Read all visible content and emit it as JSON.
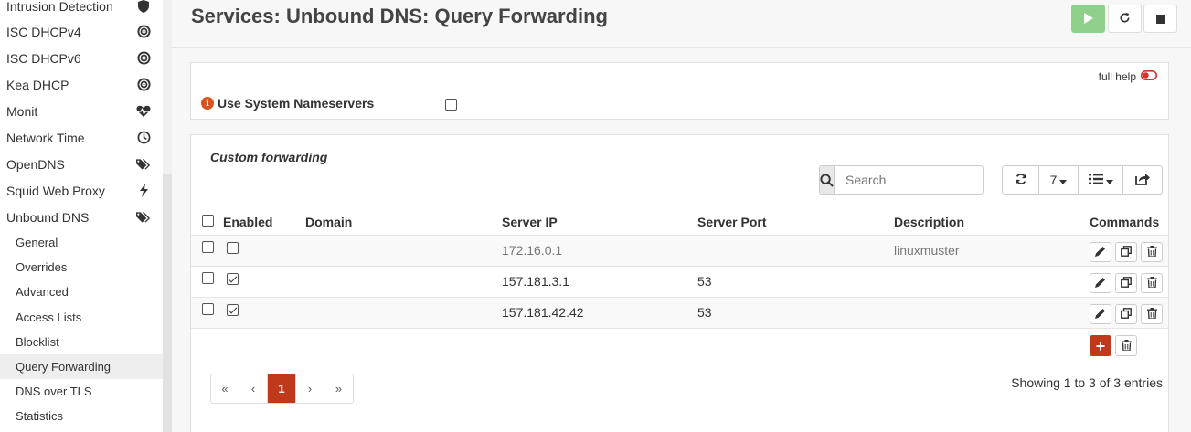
{
  "sidebar": {
    "items": [
      {
        "label": "Intrusion Detection",
        "icon": "shield-icon"
      },
      {
        "label": "ISC DHCPv4",
        "icon": "bullseye-icon"
      },
      {
        "label": "ISC DHCPv6",
        "icon": "bullseye-icon"
      },
      {
        "label": "Kea DHCP",
        "icon": "bullseye-icon"
      },
      {
        "label": "Monit",
        "icon": "heartbeat-icon"
      },
      {
        "label": "Network Time",
        "icon": "clock-icon"
      },
      {
        "label": "OpenDNS",
        "icon": "tags-icon"
      },
      {
        "label": "Squid Web Proxy",
        "icon": "bolt-icon"
      },
      {
        "label": "Unbound DNS",
        "icon": "tags-icon"
      }
    ],
    "subitems": [
      {
        "label": "General"
      },
      {
        "label": "Overrides"
      },
      {
        "label": "Advanced"
      },
      {
        "label": "Access Lists"
      },
      {
        "label": "Blocklist"
      },
      {
        "label": "Query Forwarding",
        "active": true
      },
      {
        "label": "DNS over TLS"
      },
      {
        "label": "Statistics"
      }
    ]
  },
  "header": {
    "title": "Services: Unbound DNS: Query Forwarding",
    "buttons": [
      "play-icon",
      "refresh-icon",
      "stop-icon"
    ]
  },
  "general": {
    "full_help": "full help",
    "use_system_ns_label": "Use System Nameservers",
    "use_system_ns_checked": false
  },
  "forwarding": {
    "section_title": "Custom forwarding",
    "search_placeholder": "Search",
    "page_size": "7",
    "columns": [
      "Enabled",
      "Domain",
      "Server IP",
      "Server Port",
      "Description",
      "Commands"
    ],
    "rows": [
      {
        "enabled": false,
        "domain": "",
        "server_ip": "172.16.0.1",
        "server_port": "",
        "description": "linuxmuster"
      },
      {
        "enabled": true,
        "domain": "",
        "server_ip": "157.181.3.1",
        "server_port": "53",
        "description": ""
      },
      {
        "enabled": true,
        "domain": "",
        "server_ip": "157.181.42.42",
        "server_port": "53",
        "description": ""
      }
    ],
    "pagination": {
      "first": "«",
      "prev": "‹",
      "current": "1",
      "next": "›",
      "last": "»"
    },
    "entries_info": "Showing 1 to 3 of 3 entries"
  },
  "colors": {
    "accent": "#c0391b",
    "play": "#8fd18a",
    "info": "#d9531e"
  }
}
